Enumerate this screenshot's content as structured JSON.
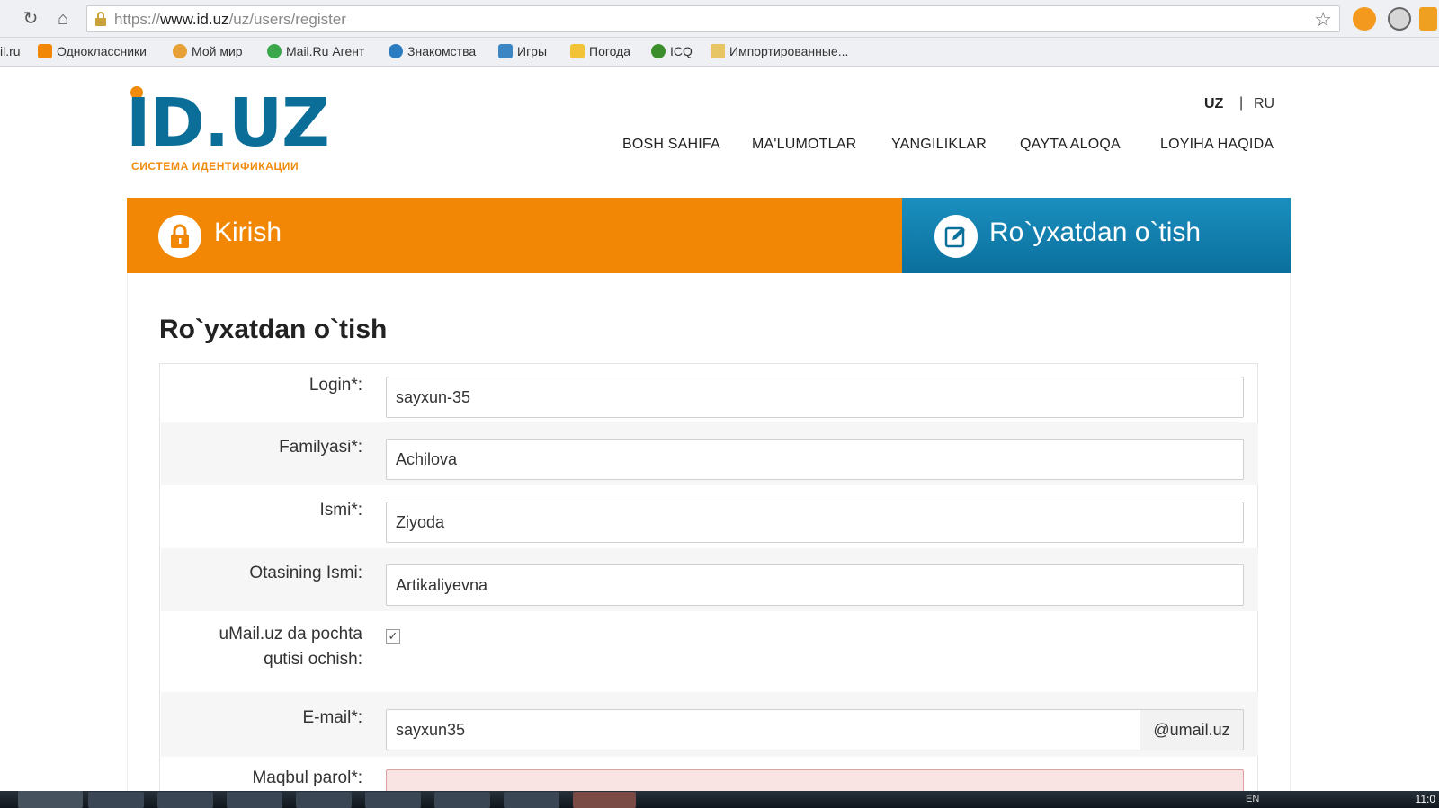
{
  "browser": {
    "url_scheme": "https://",
    "url_host": "www.id.uz",
    "url_path": "/uz/users/register",
    "bookmarks": [
      "il.ru",
      "Одноклассники",
      "Мой мир",
      "Mail.Ru Агент",
      "Знакомства",
      "Игры",
      "Погода",
      "ICQ",
      "Импортированные..."
    ]
  },
  "site": {
    "logo_text": "ID.UZ",
    "logo_subtitle": "СИСТЕМА ИДЕНТИФИКАЦИИ",
    "lang_uz": "UZ",
    "lang_sep": "|",
    "lang_ru": "RU",
    "menu": [
      "BOSH SAHIFA",
      "MA'LUMOTLAR",
      "YANGILIKLAR",
      "QAYTA ALOQA",
      "LOYIHA HAQIDA"
    ]
  },
  "tabs": {
    "login_label": "Kirish",
    "register_label": "Ro`yxatdan o`tish"
  },
  "form": {
    "title": "Ro`yxatdan o`tish",
    "login_label": "Login*:",
    "login_value": "sayxun-35",
    "familyasi_label": "Familyasi*:",
    "familyasi_value": "Achilova",
    "ismi_label": "Ismi*:",
    "ismi_value": "Ziyoda",
    "otasining_label": "Otasining Ismi:",
    "otasining_value": "Artikaliyevna",
    "umail_label_line1": "uMail.uz da pochta",
    "umail_label_line2": "qutisi ochish:",
    "umail_checked": "✓",
    "email_label": "E-mail*:",
    "email_value": "sayxun35",
    "email_suffix": "@umail.uz",
    "next_label": "Maqbul parol*:"
  },
  "taskbar": {
    "lang": "EN",
    "clock": "11:0"
  },
  "colors": {
    "orange": "#f28705",
    "blue": "#0b6f9c",
    "logo_blue": "#0b6e99"
  }
}
